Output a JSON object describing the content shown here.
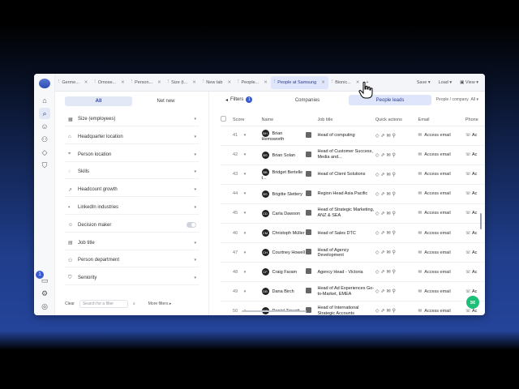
{
  "tabs": [
    {
      "label": "Germe...",
      "active": false
    },
    {
      "label": "Omose...",
      "active": false
    },
    {
      "label": "Person...",
      "active": false
    },
    {
      "label": "Size (t...",
      "active": false
    },
    {
      "label": "New tab",
      "active": false
    },
    {
      "label": "People...",
      "active": false
    },
    {
      "label": "People at Samsung",
      "active": true
    },
    {
      "label": "Bionic...",
      "active": false
    }
  ],
  "tab_actions": {
    "add": "+",
    "save": "Save",
    "load": "Load",
    "view": "View"
  },
  "filter_panel": {
    "seg_all": "All",
    "seg_net_new": "Net new",
    "items": [
      {
        "label": "Size (employees)",
        "icon": "building-icon"
      },
      {
        "label": "Headquarter location",
        "icon": "hq-icon"
      },
      {
        "label": "Person location",
        "icon": "pin-icon"
      },
      {
        "label": "Skills",
        "icon": "bulb-icon"
      },
      {
        "label": "Headcount growth",
        "icon": "growth-icon"
      },
      {
        "label": "LinkedIn industries",
        "icon": "linkedin-icon"
      },
      {
        "label": "Decision maker",
        "icon": "person-icon"
      },
      {
        "label": "Job title",
        "icon": "briefcase-icon"
      },
      {
        "label": "Person department",
        "icon": "org-icon"
      },
      {
        "label": "Seniority",
        "icon": "seniority-icon"
      }
    ],
    "clear": "Clear",
    "search_placeholder": "Search for a filter",
    "more_filters": "More filters"
  },
  "toolbar": {
    "filters": "Filters",
    "filters_count": "1",
    "companies": "Companies",
    "people": "People leads",
    "ppc_label": "People / company",
    "ppc_value": "All"
  },
  "columns": [
    "Score",
    "Name",
    "Job title",
    "Quick actions",
    "Email",
    "Phone"
  ],
  "rows": [
    {
      "num": "41",
      "name": "Brian Hemsworth",
      "initials": "BH",
      "title": "Head of computing",
      "email": "Access email"
    },
    {
      "num": "42",
      "name": "Brian Solan",
      "initials": "BS",
      "title": "Head of Customer Success, Media and...",
      "email": "Access email"
    },
    {
      "num": "43",
      "name": "Bridget Bertelle t...",
      "initials": "BB",
      "title": "Head of Client Solutions",
      "email": "Access email"
    },
    {
      "num": "44",
      "name": "Brigitte Slettery",
      "initials": "BS",
      "title": "Region Head Asia Pacific",
      "email": "Access email"
    },
    {
      "num": "45",
      "name": "Carla Dawson",
      "initials": "CD",
      "title": "Head of Strategic Marketing, ANZ & SEA",
      "email": "Access email"
    },
    {
      "num": "46",
      "name": "Christoph Müller",
      "initials": "CM",
      "title": "Head of Sales DTC",
      "email": "Access email"
    },
    {
      "num": "47",
      "name": "Courtney Howell",
      "initials": "CH",
      "title": "Head of Agency Development",
      "email": "Access email"
    },
    {
      "num": "48",
      "name": "Craig Faram",
      "initials": "CF",
      "title": "Agency Head - Victoria",
      "email": "Access email"
    },
    {
      "num": "49",
      "name": "Dana Birch",
      "initials": "DB",
      "title": "Head of Ad Experiences Go-to-Market, EMEA",
      "email": "Access email"
    },
    {
      "num": "50",
      "name": "Daniel Trevett",
      "initials": "DT",
      "title": "Head of International Strategic Accounts",
      "email": "Access email"
    }
  ],
  "phone_label": "Ac"
}
